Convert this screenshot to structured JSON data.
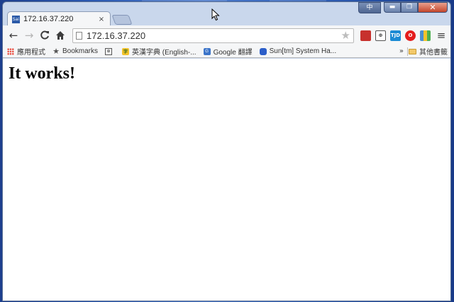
{
  "window": {
    "ime_label": "中",
    "minimize_glyph": "▬",
    "maximize_glyph": "❐",
    "close_glyph": "✕"
  },
  "tab": {
    "title": "172.16.37.220",
    "favicon_text": "Sai",
    "close_glyph": "×"
  },
  "toolbar": {
    "back_glyph": "←",
    "forward_glyph": "→",
    "reload_glyph": "C",
    "home_glyph": "⌂",
    "url": "172.16.37.220",
    "star_glyph": "★",
    "extensions": [
      {
        "name": "book-extension-icon",
        "text": ""
      },
      {
        "name": "dictionary-extension-icon",
        "text": "⊕"
      },
      {
        "name": "tjd-extension-icon",
        "text": "TJD"
      },
      {
        "name": "opera-extension-icon",
        "text": "O"
      },
      {
        "name": "bars-extension-icon",
        "text": ""
      }
    ],
    "menu_glyph": "≡"
  },
  "bookmarks": {
    "items": [
      {
        "label": "應用程式",
        "icon": "apps-icon"
      },
      {
        "label": "Bookmarks",
        "icon": "star-icon"
      },
      {
        "label": "",
        "icon": "dictionary-icon"
      },
      {
        "label": "英漢字典 (English-...",
        "icon": "yellow-dict-icon"
      },
      {
        "label": "Google 翻譯",
        "icon": "google-translate-icon"
      },
      {
        "label": "Sun[tm] System Ha...",
        "icon": "sun-icon"
      }
    ],
    "overflow_glyph": "»",
    "other_label": "其他書籤"
  },
  "page": {
    "heading": "It works!"
  },
  "colors": {
    "desktop": "#2a58b0",
    "chrome_frame": "#c9d7ec",
    "toolbar": "#f5f6f7",
    "close_button": "#c4452b"
  }
}
